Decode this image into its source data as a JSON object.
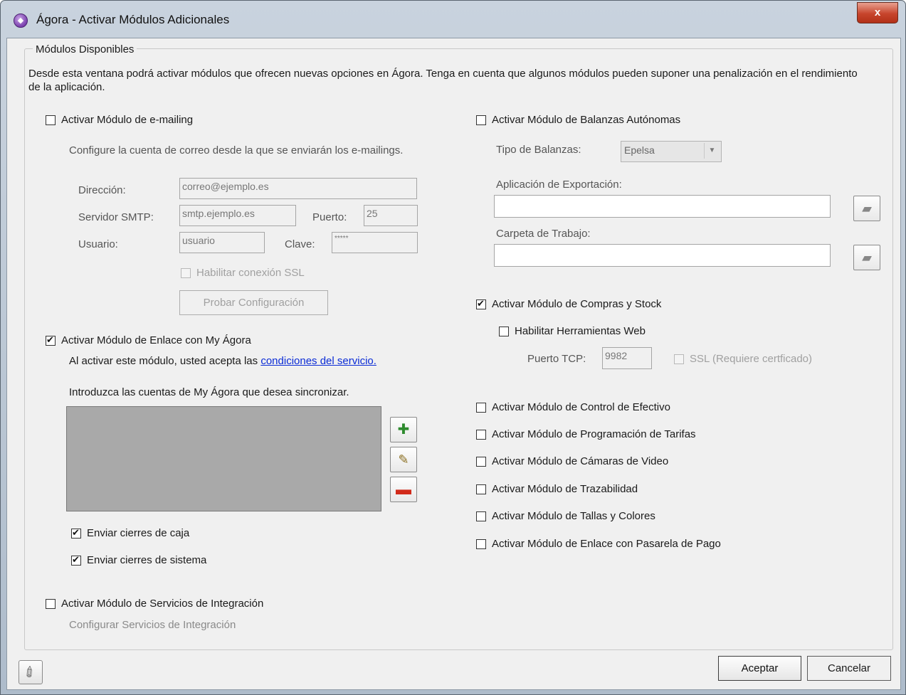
{
  "window": {
    "title": "Ágora - Activar Módulos Adicionales",
    "close_label": "x"
  },
  "group": {
    "legend": "Módulos Disponibles",
    "description": "Desde esta ventana podrá activar módulos que ofrecen nuevas opciones en Ágora. Tenga en cuenta que algunos módulos pueden suponer una penalización en el rendimiento de la aplicación."
  },
  "emailing": {
    "checkbox_label": "Activar Módulo de e-mailing",
    "checked": false,
    "config_text": "Configure la cuenta de correo desde la que se enviarán los e-mailings.",
    "address_label": "Dirección:",
    "address_value": "correo@ejemplo.es",
    "smtp_label": "Servidor SMTP:",
    "smtp_value": "smtp.ejemplo.es",
    "port_label": "Puerto:",
    "port_value": "25",
    "user_label": "Usuario:",
    "user_value": "usuario",
    "password_label": "Clave:",
    "password_value": "*****",
    "ssl_label": "Habilitar conexión SSL",
    "test_button": "Probar Configuración"
  },
  "myagora": {
    "checkbox_label": "Activar Módulo de Enlace con My Ágora",
    "checked": true,
    "accept_text": "Al activar este módulo, usted acepta las",
    "accept_link": "condiciones del servicio.",
    "accounts_text": "Introduzca las cuentas de My Ágora que desea sincronizar.",
    "send_cash_close": "Enviar cierres de caja",
    "send_system_close": "Enviar cierres de sistema"
  },
  "integration": {
    "checkbox_label": "Activar Módulo de Servicios de Integración",
    "configure_text": "Configurar Servicios de Integración"
  },
  "scales": {
    "checkbox_label": "Activar Módulo de Balanzas Autónomas",
    "type_label": "Tipo de Balanzas:",
    "type_value": "Epelsa",
    "export_label": "Aplicación de Exportación:",
    "export_value": "",
    "workdir_label": "Carpeta de Trabajo:",
    "workdir_value": ""
  },
  "purchases": {
    "checkbox_label": "Activar Módulo de Compras y Stock",
    "checked": true,
    "web_tools_label": "Habilitar Herramientas Web",
    "tcp_label": "Puerto TCP:",
    "tcp_value": "9982",
    "ssl_label": "SSL (Requiere certficado)"
  },
  "other_modules": [
    "Activar Módulo de Control de Efectivo",
    "Activar Módulo de Programación de Tarifas",
    "Activar Módulo de Cámaras de Video",
    "Activar Módulo de Trazabilidad",
    "Activar Módulo de Tallas y Colores",
    "Activar Módulo de Enlace con Pasarela de Pago"
  ],
  "footer": {
    "accept": "Aceptar",
    "cancel": "Cancelar"
  },
  "colors": {
    "link": "#0a2bd6",
    "list_background": "#a9a9a9",
    "close_button": "#c7452c"
  }
}
